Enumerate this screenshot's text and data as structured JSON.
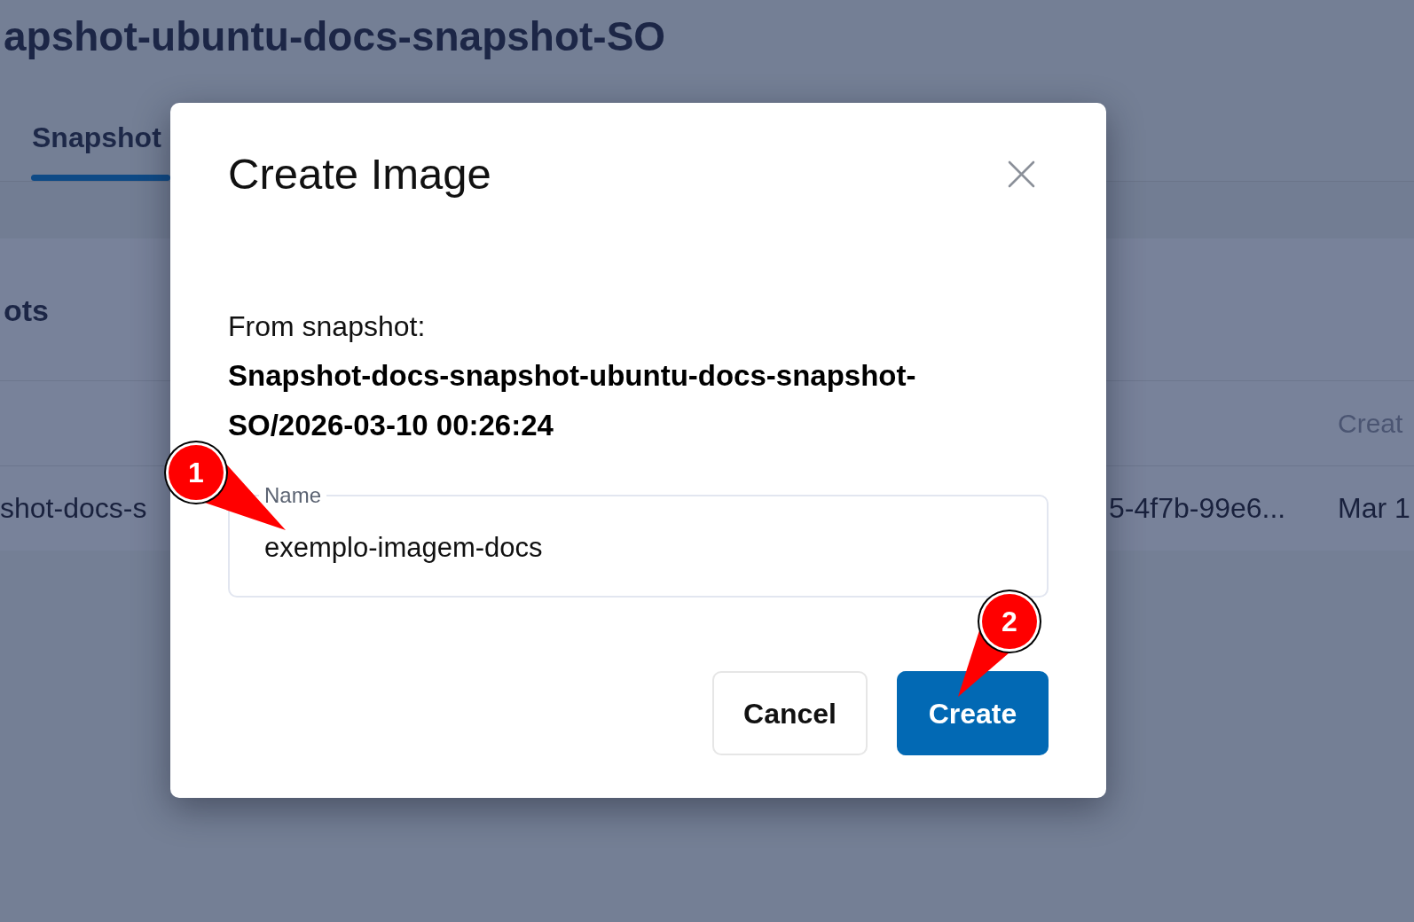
{
  "page": {
    "title": "apshot-ubuntu-docs-snapshot-SO",
    "tabs": [
      {
        "label": "Snapshot",
        "selected": true
      }
    ],
    "section_title": "ots",
    "table": {
      "columns": {
        "column_3": "Creat"
      },
      "rows": [
        {
          "cells": [
            "shot-docs-s",
            "5-4f7b-99e6...",
            "Mar 1"
          ]
        }
      ]
    }
  },
  "dialog": {
    "title": "Create Image",
    "source_label": "From snapshot:",
    "source_name": "Snapshot-docs-snapshot-ubuntu-docs-snapshot-SO/2026-03-10 00:26:24",
    "name_field": {
      "label": "Name",
      "value": "exemplo-imagem-docs"
    },
    "buttons": [
      {
        "label": "Cancel",
        "kind": "secondary"
      },
      {
        "label": "Create",
        "kind": "primary"
      }
    ]
  },
  "annotations": [
    {
      "label": "1"
    },
    {
      "label": "2"
    }
  ]
}
